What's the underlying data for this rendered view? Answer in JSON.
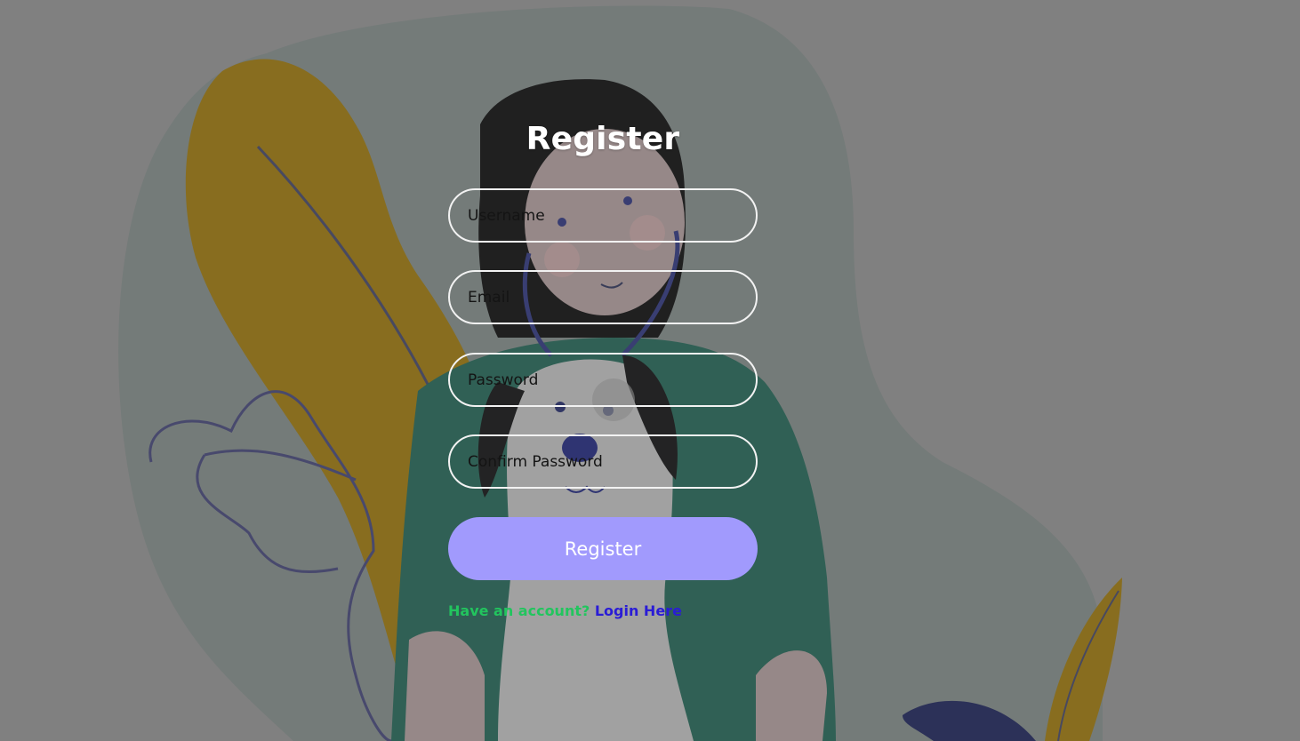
{
  "form": {
    "title": "Register",
    "username_placeholder": "Username",
    "email_placeholder": "Email",
    "password_placeholder": "Password",
    "confirm_password_placeholder": "Confirm Password",
    "submit_label": "Register"
  },
  "footer": {
    "prompt": "Have an account?",
    "link_label": "Login Here"
  },
  "colors": {
    "button_bg": "#a19afd",
    "prompt_text": "#22c55e",
    "link_text": "#2a1cd6",
    "field_border": "#f2f2f2"
  }
}
